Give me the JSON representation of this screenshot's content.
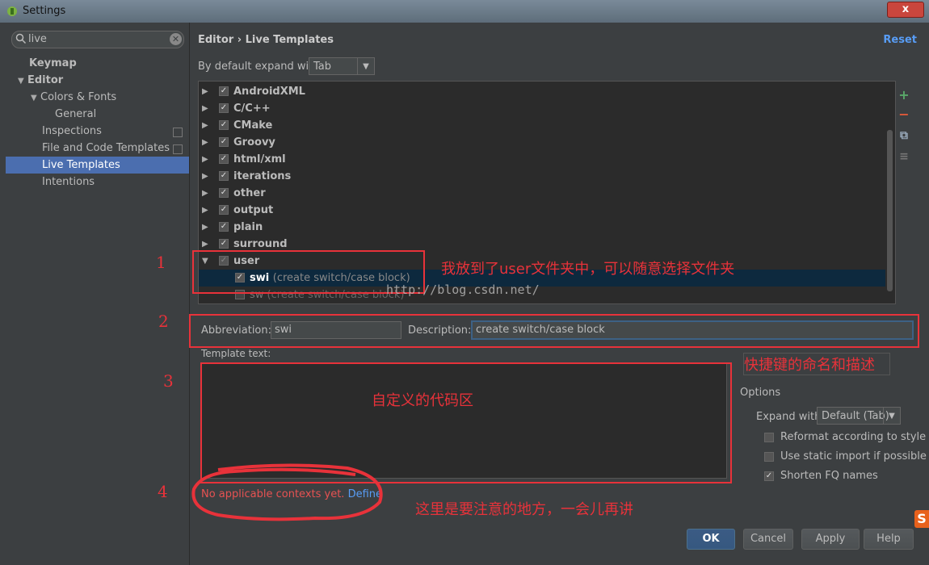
{
  "window": {
    "title": "Settings",
    "close_label": "x"
  },
  "search": {
    "value": "live",
    "clear_label": "✕"
  },
  "sidebar": {
    "items": [
      {
        "label": "Keymap",
        "bold": true
      },
      {
        "label": "Editor",
        "bold": true,
        "expanded": true
      },
      {
        "label": "Colors & Fonts",
        "expanded": true
      },
      {
        "label": "General"
      },
      {
        "label": "Inspections"
      },
      {
        "label": "File and Code Templates"
      },
      {
        "label": "Live Templates",
        "selected": true
      },
      {
        "label": "Intentions"
      }
    ]
  },
  "header": {
    "crumb1": "Editor",
    "sep": "›",
    "crumb2": "Live Templates",
    "reset": "Reset"
  },
  "expand": {
    "label": "By default expand with",
    "value": "Tab",
    "arrow": "▼"
  },
  "templates": {
    "groups": [
      "AndroidXML",
      "C/C++",
      "CMake",
      "Groovy",
      "html/xml",
      "iterations",
      "other",
      "output",
      "plain",
      "surround",
      "user"
    ],
    "items": [
      {
        "abbr": "swi",
        "desc": "(create switch/case block)",
        "checked": true,
        "selected": true
      },
      {
        "abbr": "sw",
        "desc": "(create switch/case block)",
        "checked": false
      }
    ]
  },
  "toolbar": {
    "add": "+",
    "remove": "−",
    "copy": "⧉",
    "list": "≡"
  },
  "abbr": {
    "label": "Abbreviation:",
    "value": "swi"
  },
  "descfield": {
    "label": "Description:",
    "value": "create switch/case block"
  },
  "template_text": {
    "label": "Template text:"
  },
  "options": {
    "title": "Options",
    "expand_label": "Expand with",
    "expand_value": "Default (Tab)",
    "checks": [
      {
        "label": "Reformat according to style",
        "checked": false
      },
      {
        "label": "Use static import if possible",
        "checked": false
      },
      {
        "label": "Shorten FQ names",
        "checked": true
      }
    ]
  },
  "context": {
    "message": "No applicable contexts yet.",
    "define": "Define"
  },
  "buttons": {
    "ok": "OK",
    "cancel": "Cancel",
    "apply": "Apply",
    "help": "Help"
  },
  "annotations": {
    "n1": "1",
    "n2": "2",
    "n3": "3",
    "n4": "4",
    "t1": "我放到了user文件夹中，可以随意选择文件夹",
    "t2": "快捷键的命名和描述",
    "t3": "自定义的代码区",
    "t4": "这里是要注意的地方，一会儿再讲"
  },
  "watermark": "http://blog.csdn.net/",
  "colors": {
    "accent": "#4b6eaf",
    "annotation": "#e8323a",
    "link": "#589df6",
    "error": "#e75252"
  }
}
